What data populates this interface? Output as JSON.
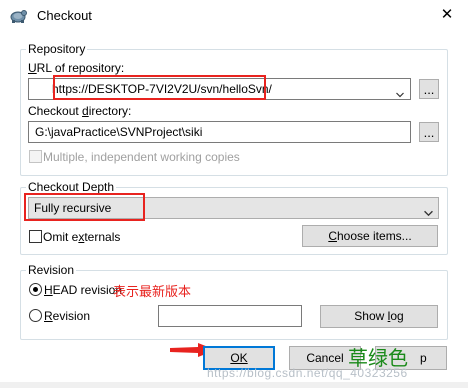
{
  "window": {
    "title": "Checkout",
    "close_glyph": "✕"
  },
  "repository": {
    "group_label": "Repository",
    "url_label_key": "U",
    "url_label_rest": "RL of repository:",
    "url_value": "https://DESKTOP-7VI2V2U/svn/helloSvn/",
    "browse_label": "...",
    "dir_label_pre": "Checkout ",
    "dir_label_key": "d",
    "dir_label_rest": "irectory:",
    "dir_value": "G:\\javaPractice\\SVNProject\\siki",
    "dir_browse_label": "...",
    "multiple_label": "Multiple, independent working copies"
  },
  "depth": {
    "group_label": "Checkout Depth",
    "selected": "Fully recursive",
    "omit_label_pre": "Omit e",
    "omit_label_key": "x",
    "omit_label_rest": "ternals",
    "choose_label_key": "C",
    "choose_label_rest": "hoose items..."
  },
  "revision": {
    "group_label": "Revision",
    "head_label_key": "H",
    "head_label_rest": "EAD revision",
    "revision_label_key": "R",
    "revision_label_rest": "evision",
    "revision_value": "",
    "show_log_pre": "Show ",
    "show_log_key": "l",
    "show_log_rest": "og"
  },
  "buttons": {
    "ok": "OK",
    "cancel": "Cancel",
    "help_fragment": "p"
  },
  "annotations": {
    "head_note": "表示最新版本",
    "author_note": "草绿色",
    "watermark": "https://blog.csdn.net/qq_40323256"
  },
  "colors": {
    "highlight_red": "#e8231f",
    "author_green": "#1a8a1a",
    "focus_blue": "#0078d7"
  },
  "icons": {
    "app": "tortoise-svn-icon",
    "close": "close-icon",
    "dropdown": "chevron-down-icon",
    "arrow": "red-arrow-icon"
  }
}
